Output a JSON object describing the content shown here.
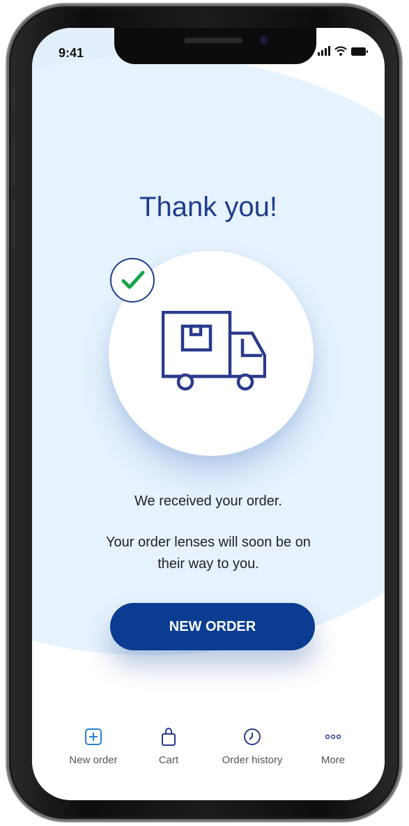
{
  "status_bar": {
    "time": "9:41"
  },
  "main": {
    "title": "Thank you!",
    "message_received": "We received your order.",
    "message_line1": "Your order lenses will soon be on",
    "message_line2": "their way to you.",
    "new_order_button": "NEW ORDER"
  },
  "bottom_nav": {
    "items": [
      {
        "label": "New order",
        "icon": "plus-square-icon"
      },
      {
        "label": "Cart",
        "icon": "shopping-bag-icon"
      },
      {
        "label": "Order history",
        "icon": "clock-icon"
      },
      {
        "label": "More",
        "icon": "more-dots-icon"
      }
    ]
  },
  "colors": {
    "primary": "#0a3d91",
    "title": "#1f3d8c",
    "background_circle": "#e3f0fc",
    "check_green": "#17a34a",
    "nav_icon": "#2b7fd6"
  }
}
